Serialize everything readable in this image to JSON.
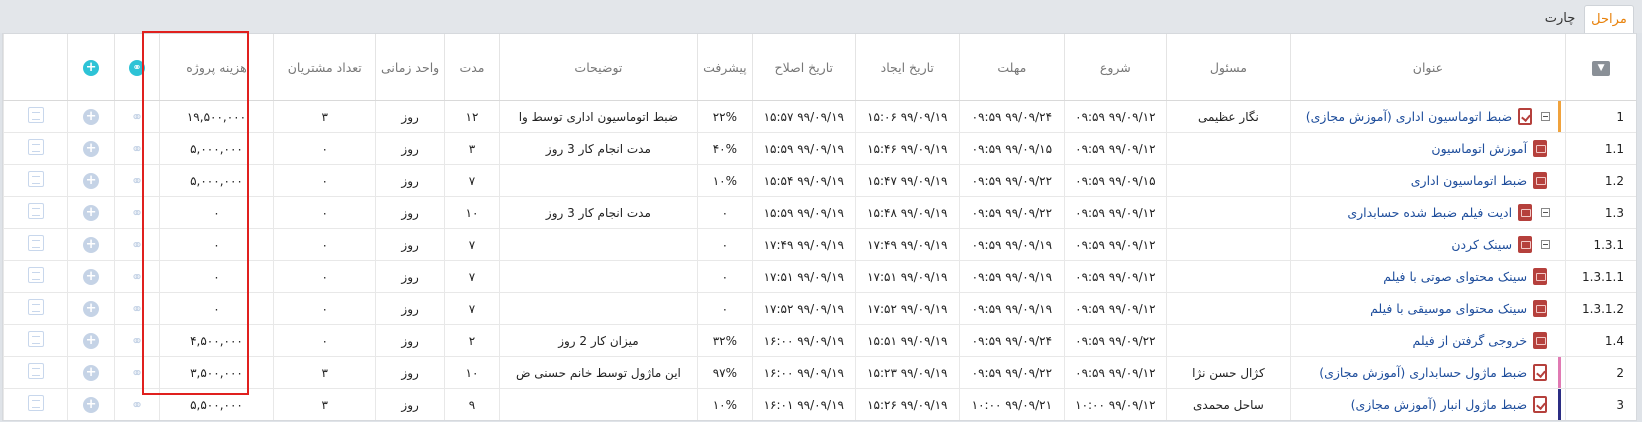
{
  "tabs": [
    {
      "label": "مراحل",
      "active": true
    },
    {
      "label": "چارت",
      "active": false
    }
  ],
  "headers": {
    "row_num": "",
    "title": "عنوان",
    "owner": "مسئول",
    "start": "شروع",
    "deadline": "مهلت",
    "created": "تاریخ ایجاد",
    "modified": "تاریخ اصلاح",
    "progress": "پیشرفت",
    "description": "توضیحات",
    "duration": "مدت",
    "time_unit": "واحد زمانی",
    "customers": "تعداد مشتریان",
    "cost": "هزینه پروژه"
  },
  "accent_colors": {
    "stripe_orange": "#f0a23c",
    "stripe_pink": "#e07ab3",
    "stripe_navy": "#2b2d83",
    "highlight": "#e0201e"
  },
  "rows": [
    {
      "num": "1",
      "indent": 0,
      "icon": "task",
      "collapse": true,
      "stripe": "#f0a23c",
      "title": "ضبط اتوماسیون اداری (آموزش مجازی)",
      "owner": "نگار عظیمی",
      "start": "۰۹:۵۹ ۹۹/۰۹/۱۲",
      "deadline": "۰۹:۵۹ ۹۹/۰۹/۲۴",
      "created": "۱۵:۰۶ ۹۹/۰۹/۱۹",
      "modified": "۱۵:۵۷ ۹۹/۰۹/۱۹",
      "progress": "۲۲%",
      "description": "ضبط اتوماسیون اداری توسط وا",
      "duration": "۱۲",
      "time_unit": "روز",
      "customers": "۳",
      "cost": "۱۹,۵۰۰,۰۰۰"
    },
    {
      "num": "1.1",
      "indent": 1,
      "icon": "red",
      "collapse": false,
      "stripe": "",
      "title": "آموزش اتوماسیون",
      "owner": "",
      "start": "۰۹:۵۹ ۹۹/۰۹/۱۲",
      "deadline": "۰۹:۵۹ ۹۹/۰۹/۱۵",
      "created": "۱۵:۴۶ ۹۹/۰۹/۱۹",
      "modified": "۱۵:۵۹ ۹۹/۰۹/۱۹",
      "progress": "۴۰%",
      "description": "مدت انجام کار 3 روز",
      "duration": "۳",
      "time_unit": "روز",
      "customers": "۰",
      "cost": "۵,۰۰۰,۰۰۰"
    },
    {
      "num": "1.2",
      "indent": 1,
      "icon": "red",
      "collapse": false,
      "stripe": "",
      "title": "ضبط اتوماسیون اداری",
      "owner": "",
      "start": "۰۹:۵۹ ۹۹/۰۹/۱۵",
      "deadline": "۰۹:۵۹ ۹۹/۰۹/۲۲",
      "created": "۱۵:۴۷ ۹۹/۰۹/۱۹",
      "modified": "۱۵:۵۴ ۹۹/۰۹/۱۹",
      "progress": "۱۰%",
      "description": "",
      "duration": "۷",
      "time_unit": "روز",
      "customers": "۰",
      "cost": "۵,۰۰۰,۰۰۰"
    },
    {
      "num": "1.3",
      "indent": 1,
      "icon": "red",
      "collapse": true,
      "stripe": "",
      "title": "ادیت فیلم ضبط شده حسابداری",
      "owner": "",
      "start": "۰۹:۵۹ ۹۹/۰۹/۱۲",
      "deadline": "۰۹:۵۹ ۹۹/۰۹/۲۲",
      "created": "۱۵:۴۸ ۹۹/۰۹/۱۹",
      "modified": "۱۵:۵۹ ۹۹/۰۹/۱۹",
      "progress": "۰",
      "description": "مدت انجام کار 3 روز",
      "duration": "۱۰",
      "time_unit": "روز",
      "customers": "۰",
      "cost": "۰"
    },
    {
      "num": "1.3.1",
      "indent": 2,
      "icon": "red",
      "collapse": true,
      "stripe": "",
      "title": "سینک کردن",
      "owner": "",
      "start": "۰۹:۵۹ ۹۹/۰۹/۱۲",
      "deadline": "۰۹:۵۹ ۹۹/۰۹/۱۹",
      "created": "۱۷:۴۹ ۹۹/۰۹/۱۹",
      "modified": "۱۷:۴۹ ۹۹/۰۹/۱۹",
      "progress": "۰",
      "description": "",
      "duration": "۷",
      "time_unit": "روز",
      "customers": "۰",
      "cost": "۰"
    },
    {
      "num": "1.3.1.1",
      "indent": 3,
      "icon": "red",
      "collapse": false,
      "stripe": "",
      "title": "سینک محتوای صوتی با فیلم",
      "owner": "",
      "start": "۰۹:۵۹ ۹۹/۰۹/۱۲",
      "deadline": "۰۹:۵۹ ۹۹/۰۹/۱۹",
      "created": "۱۷:۵۱ ۹۹/۰۹/۱۹",
      "modified": "۱۷:۵۱ ۹۹/۰۹/۱۹",
      "progress": "۰",
      "description": "",
      "duration": "۷",
      "time_unit": "روز",
      "customers": "۰",
      "cost": "۰"
    },
    {
      "num": "1.3.1.2",
      "indent": 3,
      "icon": "red",
      "collapse": false,
      "stripe": "",
      "title": "سینک محتوای موسیقی با فیلم",
      "owner": "",
      "start": "۰۹:۵۹ ۹۹/۰۹/۱۲",
      "deadline": "۰۹:۵۹ ۹۹/۰۹/۱۹",
      "created": "۱۷:۵۲ ۹۹/۰۹/۱۹",
      "modified": "۱۷:۵۲ ۹۹/۰۹/۱۹",
      "progress": "۰",
      "description": "",
      "duration": "۷",
      "time_unit": "روز",
      "customers": "۰",
      "cost": "۰"
    },
    {
      "num": "1.4",
      "indent": 1,
      "icon": "red",
      "collapse": false,
      "stripe": "",
      "title": "خروجی گرفتن از فیلم",
      "owner": "",
      "start": "۰۹:۵۹ ۹۹/۰۹/۲۲",
      "deadline": "۰۹:۵۹ ۹۹/۰۹/۲۴",
      "created": "۱۵:۵۱ ۹۹/۰۹/۱۹",
      "modified": "۱۶:۰۰ ۹۹/۰۹/۱۹",
      "progress": "۳۲%",
      "description": "میزان کار 2 روز",
      "duration": "۲",
      "time_unit": "روز",
      "customers": "۰",
      "cost": "۴,۵۰۰,۰۰۰"
    },
    {
      "num": "2",
      "indent": 0,
      "icon": "task",
      "collapse": false,
      "stripe": "#e07ab3",
      "title": "ضبط ماژول حسابداری (آموزش مجازی)",
      "owner": "کژال حسن نژا",
      "start": "۰۹:۵۹ ۹۹/۰۹/۱۲",
      "deadline": "۰۹:۵۹ ۹۹/۰۹/۲۲",
      "created": "۱۵:۲۳ ۹۹/۰۹/۱۹",
      "modified": "۱۶:۰۰ ۹۹/۰۹/۱۹",
      "progress": "۹۷%",
      "description": "این ماژول توسط خانم حسنی ض",
      "duration": "۱۰",
      "time_unit": "روز",
      "customers": "۳",
      "cost": "۳,۵۰۰,۰۰۰"
    },
    {
      "num": "3",
      "indent": 0,
      "icon": "task",
      "collapse": false,
      "stripe": "#2b2d83",
      "title": "ضبط ماژول انبار (آموزش مجازی)",
      "owner": "ساحل محمدی",
      "start": "۱۰:۰۰ ۹۹/۰۹/۱۲",
      "deadline": "۱۰:۰۰ ۹۹/۰۹/۲۱",
      "created": "۱۵:۲۶ ۹۹/۰۹/۱۹",
      "modified": "۱۶:۰۱ ۹۹/۰۹/۱۹",
      "progress": "۱۰%",
      "description": "",
      "duration": "۹",
      "time_unit": "روز",
      "customers": "۳",
      "cost": "۵,۵۰۰,۰۰۰"
    }
  ]
}
